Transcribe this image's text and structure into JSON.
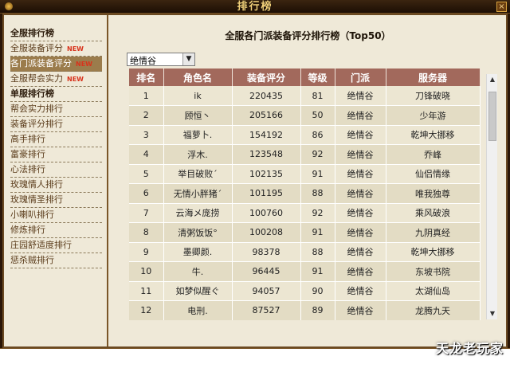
{
  "window": {
    "title": "排行榜",
    "close_label": "×"
  },
  "sidebar": {
    "items": [
      {
        "label": "全服排行榜",
        "type": "heading",
        "new": ""
      },
      {
        "label": "全服装备评分",
        "type": "link",
        "new": "NEW"
      },
      {
        "label": "各门派装备评分",
        "type": "link",
        "new": "NEW",
        "active": true
      },
      {
        "label": "全服帮会实力",
        "type": "link",
        "new": "NEW"
      },
      {
        "label": "单服排行榜",
        "type": "heading",
        "new": ""
      },
      {
        "label": "帮会实力排行",
        "type": "link",
        "new": ""
      },
      {
        "label": "装备评分排行",
        "type": "link",
        "new": ""
      },
      {
        "label": "高手排行",
        "type": "link",
        "new": ""
      },
      {
        "label": "富豪排行",
        "type": "link",
        "new": ""
      },
      {
        "label": "心法排行",
        "type": "link",
        "new": ""
      },
      {
        "label": "玫瑰情人排行",
        "type": "link",
        "new": ""
      },
      {
        "label": "玫瑰情圣排行",
        "type": "link",
        "new": ""
      },
      {
        "label": "小喇叭排行",
        "type": "link",
        "new": ""
      },
      {
        "label": "修炼排行",
        "type": "link",
        "new": ""
      },
      {
        "label": "庄园舒适度排行",
        "type": "link",
        "new": ""
      },
      {
        "label": "惩杀贼排行",
        "type": "link",
        "new": ""
      }
    ]
  },
  "main": {
    "title": "全服各门派装备评分排行榜（Top50）",
    "sect_select": {
      "value": "绝情谷",
      "arrow": "▼"
    },
    "table": {
      "headers": [
        "排名",
        "角色名",
        "装备评分",
        "等级",
        "门派",
        "服务器"
      ],
      "rows": [
        [
          "1",
          "ik",
          "220435",
          "81",
          "绝情谷",
          "刀锋破晓"
        ],
        [
          "2",
          "顾恒丶",
          "205166",
          "50",
          "绝情谷",
          "少年游"
        ],
        [
          "3",
          "福萝卜.",
          "154192",
          "86",
          "绝情谷",
          "乾坤大挪移"
        ],
        [
          "4",
          "浮木.",
          "123548",
          "92",
          "绝情谷",
          "乔峰"
        ],
        [
          "5",
          "举目破败ˊ",
          "102135",
          "91",
          "绝情谷",
          "仙侣情缘"
        ],
        [
          "6",
          "无情小胖猪ˊ",
          "101195",
          "88",
          "绝情谷",
          "唯我独尊"
        ],
        [
          "7",
          "云海メ庞捞",
          "100760",
          "92",
          "绝情谷",
          "乘风破浪"
        ],
        [
          "8",
          "清粥饭饭°",
          "100208",
          "91",
          "绝情谷",
          "九阴真经"
        ],
        [
          "9",
          "墨卿颜.",
          "98378",
          "88",
          "绝情谷",
          "乾坤大挪移"
        ],
        [
          "10",
          "牛.",
          "96445",
          "91",
          "绝情谷",
          "东坡书院"
        ],
        [
          "11",
          "如梦似醒ぐ",
          "94057",
          "90",
          "绝情谷",
          "太湖仙岛"
        ],
        [
          "12",
          "电刑.",
          "87527",
          "89",
          "绝情谷",
          "龙腾九天"
        ],
        [
          "13",
          "",
          "",
          "",
          "",
          ""
        ]
      ]
    },
    "scrollbar": {
      "up": "▲",
      "down": "▼"
    }
  },
  "watermark": "天龙老玩家"
}
